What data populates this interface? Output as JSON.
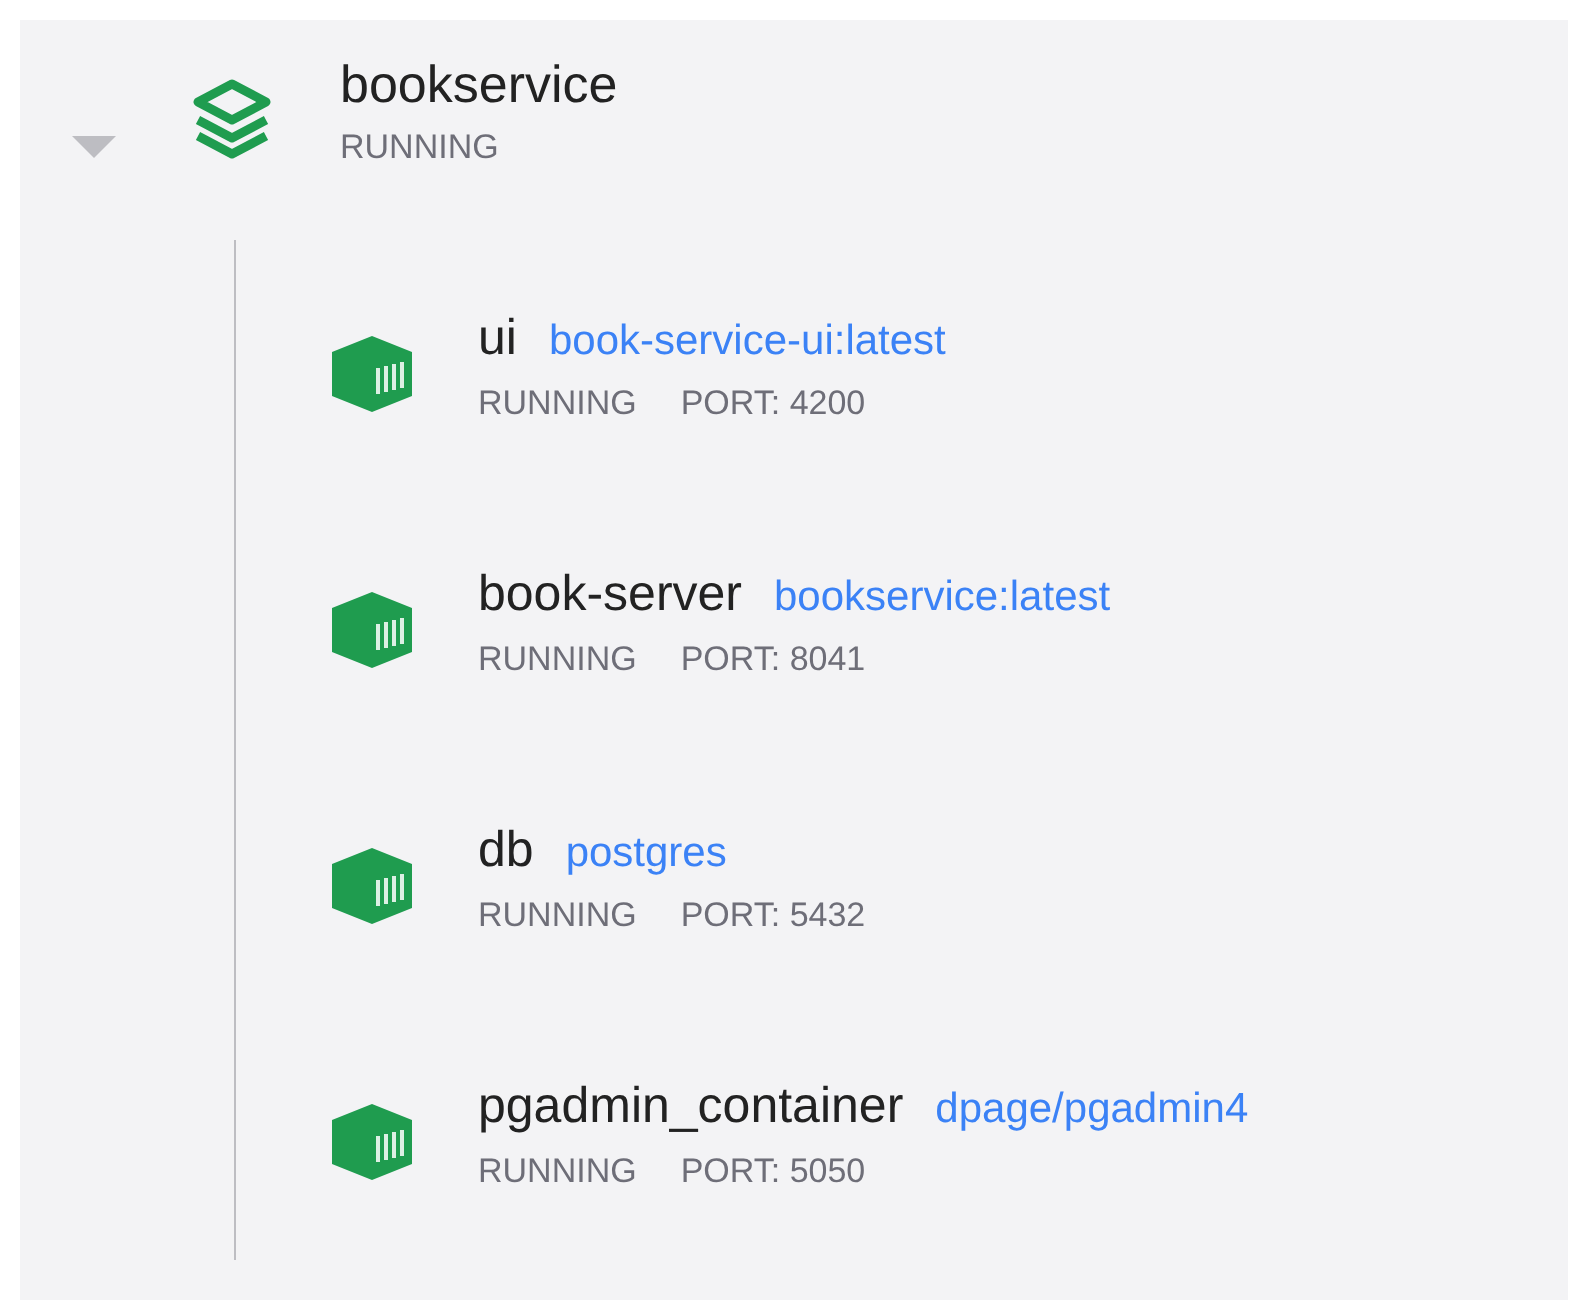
{
  "app": {
    "name": "bookservice",
    "status": "RUNNING",
    "expanded": true,
    "containers": [
      {
        "name": "ui",
        "image": "book-service-ui:latest",
        "status": "RUNNING",
        "port": "PORT: 4200"
      },
      {
        "name": "book-server",
        "image": "bookservice:latest",
        "status": "RUNNING",
        "port": "PORT: 8041"
      },
      {
        "name": "db",
        "image": "postgres",
        "status": "RUNNING",
        "port": "PORT: 5432"
      },
      {
        "name": "pgadmin_container",
        "image": "dpage/pgadmin4",
        "status": "RUNNING",
        "port": "PORT: 5050"
      }
    ]
  }
}
